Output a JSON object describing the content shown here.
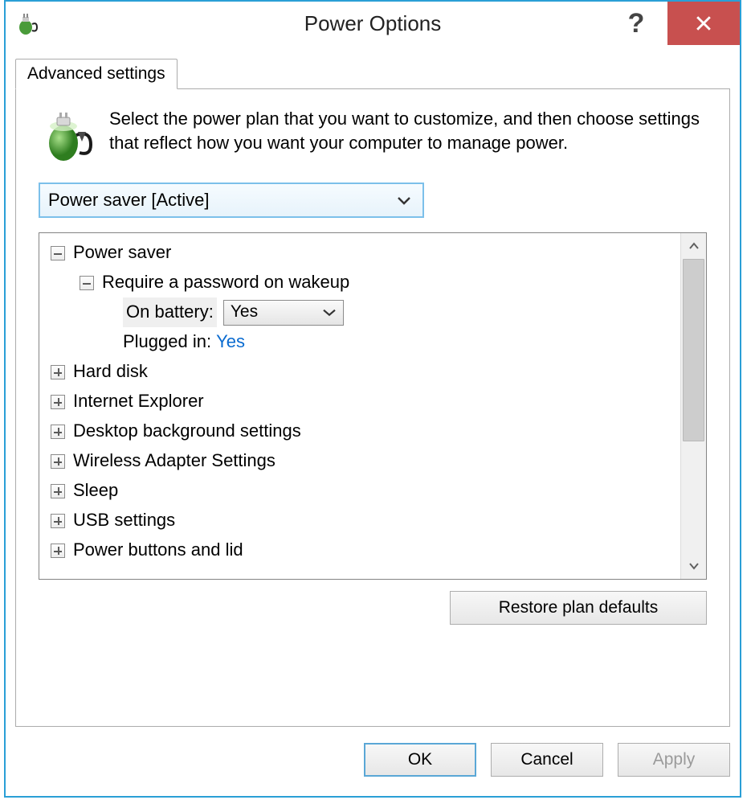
{
  "window": {
    "title": "Power Options"
  },
  "tab": {
    "label": "Advanced settings"
  },
  "intro": {
    "text": "Select the power plan that you want to customize, and then choose settings that reflect how you want your computer to manage power."
  },
  "plan_combo": {
    "selected": "Power saver [Active]"
  },
  "tree": {
    "root_label": "Power saver",
    "password_node": "Require a password on wakeup",
    "on_battery_label": "On battery:",
    "on_battery_value": "Yes",
    "plugged_in_label": "Plugged in:",
    "plugged_in_value": "Yes",
    "items": {
      "hard_disk": "Hard disk",
      "ie": "Internet Explorer",
      "desktop_bg": "Desktop background settings",
      "wireless": "Wireless Adapter Settings",
      "sleep": "Sleep",
      "usb": "USB settings",
      "power_buttons": "Power buttons and lid"
    }
  },
  "buttons": {
    "restore": "Restore plan defaults",
    "ok": "OK",
    "cancel": "Cancel",
    "apply": "Apply"
  }
}
